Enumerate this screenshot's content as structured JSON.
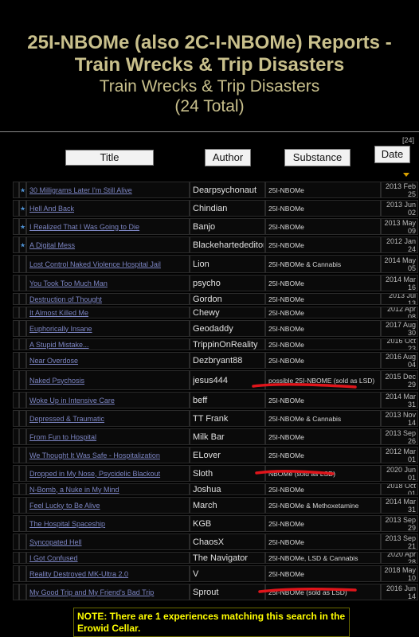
{
  "page": {
    "title_line1": "25I-NBOMe (also 2C-I-NBOMe) Reports -",
    "title_line2": "Train Wrecks & Trip Disasters",
    "title_line3": "Train Wrecks & Trip Disasters",
    "title_line4": "(24 Total)",
    "count_label": "[24]"
  },
  "headers": {
    "title": "Title",
    "author": "Author",
    "substance": "Substance",
    "date": "Date"
  },
  "rows": [
    {
      "stars": "★★",
      "title": "30 Milligrams Later I'm Still Alive",
      "author": "Dearpsychonaut",
      "substance": "25I-NBOMe",
      "date_a": "2013 Feb",
      "date_b": "25"
    },
    {
      "stars": "★",
      "title": "Hell And Back",
      "author": "Chindian",
      "substance": "25I-NBOMe",
      "date_a": "2013 Jun",
      "date_b": "02"
    },
    {
      "stars": "★",
      "title": "I Realized That I Was Going to Die",
      "author": "Banjo",
      "substance": "25I-NBOMe",
      "date_a": "2013 May",
      "date_b": "09"
    },
    {
      "stars": "★★",
      "title": "A Digital Mess",
      "author": "Blackehartededitor",
      "substance": "25I-NBOMe",
      "date_a": "2012 Jan",
      "date_b": "24"
    },
    {
      "stars": "",
      "title": "Lost Control Naked Violence Hospital Jail",
      "author": "Lion",
      "substance": "25I-NBOMe & Cannabis",
      "date_a": "2014 May",
      "date_b": "05"
    },
    {
      "stars": "",
      "title": "You Took Too Much Man",
      "author": "psycho",
      "substance": "25I-NBOMe",
      "date_a": "2014 Mar",
      "date_b": "16"
    },
    {
      "stars": "",
      "title": "Destruction of Thought",
      "author": "Gordon",
      "substance": "25I-NBOMe",
      "date_a": "2013 Jul 13",
      "date_b": ""
    },
    {
      "stars": "",
      "title": "It Almost Killed Me",
      "author": "Chewy",
      "substance": "25I-NBOMe",
      "date_a": "2012 Apr 08",
      "date_b": ""
    },
    {
      "stars": "",
      "title": "Euphorically Insane",
      "author": "Geodaddy",
      "substance": "25I-NBOMe",
      "date_a": "2017 Aug",
      "date_b": "30"
    },
    {
      "stars": "",
      "title": "A Stupid Mistake...",
      "author": "TrippinOnReality",
      "substance": "25I-NBOMe",
      "date_a": "2016 Oct 23",
      "date_b": ""
    },
    {
      "stars": "",
      "title": "Near Overdose",
      "author": "Dezbryant88",
      "substance": "25I-NBOMe",
      "date_a": "2016 Aug",
      "date_b": "04"
    },
    {
      "stars": "",
      "title": "Naked Psychosis",
      "author": "jesus444",
      "substance": "possible 25I-NBOME (sold as LSD)",
      "date_a": "2015 Dec",
      "date_b": "29"
    },
    {
      "stars": "",
      "title": "Woke Up in Intensive Care",
      "author": "beff",
      "substance": "25I-NBOMe",
      "date_a": "2014 Mar",
      "date_b": "31"
    },
    {
      "stars": "",
      "title": "Depressed & Traumatic",
      "author": "TT Frank",
      "substance": "25I-NBOMe & Cannabis",
      "date_a": "2013 Nov",
      "date_b": "14"
    },
    {
      "stars": "",
      "title": "From Fun to Hospital",
      "author": "Milk Bar",
      "substance": "25I-NBOMe",
      "date_a": "2013 Sep",
      "date_b": "26"
    },
    {
      "stars": "",
      "title": "We Thought It Was Safe - Hospitalization",
      "author": "ELover",
      "substance": "25I-NBOMe",
      "date_a": "2012 Mar",
      "date_b": "01"
    },
    {
      "stars": "",
      "title": "Dropped in My Nose, Psycidelic Blackout",
      "author": "Sloth",
      "substance": "NBOMe (sold as LSD)",
      "date_a": "2020 Jun",
      "date_b": "01"
    },
    {
      "stars": "",
      "title": "N-Bomb, a Nuke in My Mind",
      "author": "Joshua",
      "substance": "25I-NBOMe",
      "date_a": "2018 Oct 01",
      "date_b": ""
    },
    {
      "stars": "",
      "title": "Feel Lucky to Be Alive",
      "author": "March",
      "substance": "25I-NBOMe & Methoxetamine",
      "date_a": "2014 Mar",
      "date_b": "31"
    },
    {
      "stars": "",
      "title": "The Hospital Spaceship",
      "author": "KGB",
      "substance": "25I-NBOMe",
      "date_a": "2013 Sep",
      "date_b": "29"
    },
    {
      "stars": "",
      "title": "Syncopated Hell",
      "author": "ChaosX",
      "substance": "25I-NBOMe",
      "date_a": "2013 Sep",
      "date_b": "21"
    },
    {
      "stars": "",
      "title": "I Got Confused",
      "author": "The Navigator",
      "substance": "25I-NBOMe, LSD & Cannabis",
      "date_a": "2020 Apr 28",
      "date_b": ""
    },
    {
      "stars": "",
      "title": "Reality Destroyed MK-Ultra 2.0",
      "author": "V",
      "substance": "25I-NBOMe",
      "date_a": "2018 May",
      "date_b": "10"
    },
    {
      "stars": "",
      "title": "My Good Trip and My Friend's Bad Trip",
      "author": "Sprout",
      "substance": "25I-NBOMe (sold as LSD)",
      "date_a": "2016 Jun",
      "date_b": "14"
    }
  ],
  "note": {
    "text": "NOTE: There are 1 experiences matching this search in the Erowid Cellar."
  },
  "colors": {
    "title": "#c9c08c",
    "link": "#7d86c4",
    "star": "#4e8fd0",
    "note": "#ffff00",
    "annotation": "#e0151b"
  }
}
